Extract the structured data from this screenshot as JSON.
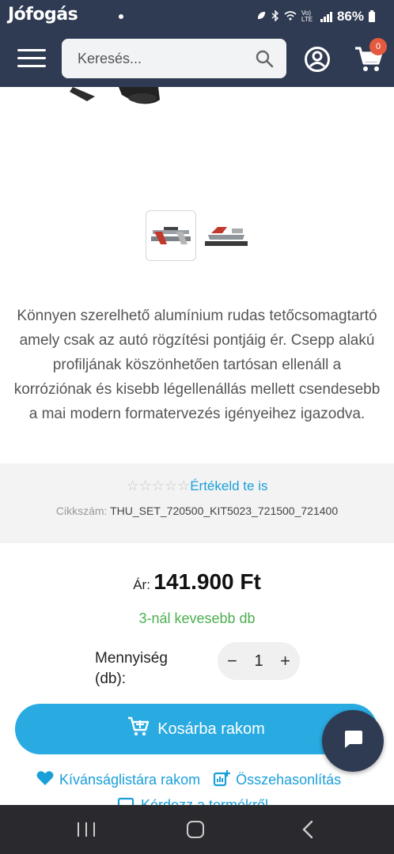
{
  "status_bar": {
    "time": "Jófogás",
    "battery": "86%",
    "net": "Vo) LTE"
  },
  "header": {
    "search": {
      "placeholder": "Keresés..."
    },
    "cart_count": "0"
  },
  "product": {
    "description": "Könnyen szerelhető alumínium rudas tetőcsomagtartó amely csak az autó rögzítési pontjáig ér. Csepp alakú profiljának köszönhetően tartósan ellenáll a korróziónak és kisebb légellenállás mellett csendesebb a mai modern formatervezés igényeihez igazodva.",
    "rating_stars": "☆☆☆☆☆",
    "rate_link": "Értékeld te is",
    "sku_label": "Cikkszám:",
    "sku_value": "THU_SET_720500_KIT5023_721500_721400",
    "price_label": "Ár:",
    "price_value": "141.900 Ft",
    "stock": "3-nál kevesebb db",
    "quantity_label": "Mennyiség (db):",
    "quantity_value": "1",
    "add_to_cart": "Kosárba rakom",
    "wishlist": "Kívánságlistára rakom",
    "compare": "Összehasonlítás",
    "ask": "Kérdezz a termékről"
  },
  "colors": {
    "header_bg": "#2f3b52",
    "accent": "#29abe2",
    "link": "#1a9fd9",
    "stock": "#4caf50",
    "badge": "#e55a3f"
  }
}
